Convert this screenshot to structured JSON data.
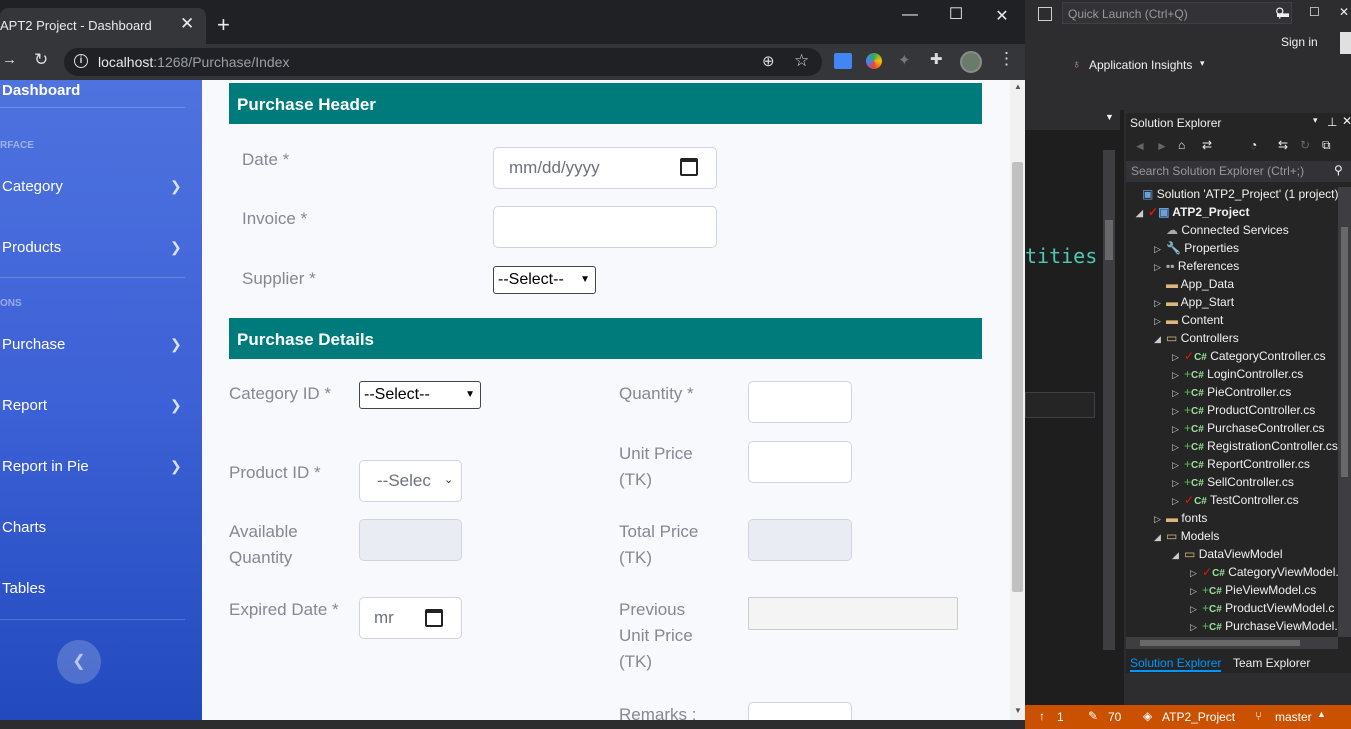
{
  "browser": {
    "tab_title": "APT2 Project - Dashboard",
    "url_host": "localhost",
    "url_rest": ":1268/Purchase/Index"
  },
  "sidebar": {
    "title": "Dashboard",
    "heading1": "RFACE",
    "heading2": "ONS",
    "items": [
      {
        "label": "Category"
      },
      {
        "label": "Products"
      },
      {
        "label": "Purchase"
      },
      {
        "label": "Report"
      },
      {
        "label": "Report in Pie"
      },
      {
        "label": "Charts"
      },
      {
        "label": "Tables"
      }
    ]
  },
  "form": {
    "header_title": "Purchase Header",
    "date_label": "Date *",
    "date_placeholder": "mm/dd/yyyy",
    "invoice_label": "Invoice *",
    "supplier_label": "Supplier *",
    "supplier_value": "--Select--",
    "details_title": "Purchase Details",
    "category_label": "Category ID *",
    "category_value": "--Select--",
    "product_label": "Product ID *",
    "product_value": "--Selec",
    "available_label": "Available Quantity",
    "expired_label": "Expired Date *",
    "expired_value": "mr",
    "quantity_label": "Quantity *",
    "unit_price_label": "Unit Price (TK)",
    "total_price_label": "Total Price (TK)",
    "prev_price_label": "Previous Unit Price (TK)",
    "remarks_label": "Remarks :"
  },
  "vs": {
    "quick_launch": "Quick Launch (Ctrl+Q)",
    "sign_in": "Sign in",
    "insights": "Application Insights",
    "code_text": "tities",
    "se_title": "Solution Explorer",
    "se_search": "Search Solution Explorer (Ctrl+;)",
    "tree": [
      "Solution 'ATP2_Project' (1 project)",
      "ATP2_Project",
      "Connected Services",
      "Properties",
      "References",
      "App_Data",
      "App_Start",
      "Content",
      "Controllers",
      "CategoryController.cs",
      "LoginController.cs",
      "PieController.cs",
      "ProductController.cs",
      "PurchaseController.cs",
      "RegistrationController.cs",
      "ReportController.cs",
      "SellController.cs",
      "TestController.cs",
      "fonts",
      "Models",
      "DataViewModel",
      "CategoryViewModel.",
      "PieViewModel.cs",
      "ProductViewModel.c",
      "PurchaseViewModel."
    ],
    "tab_se": "Solution Explorer",
    "tab_te": "Team Explorer",
    "status": {
      "arrow_count": "1",
      "pencil_count": "70",
      "project": "ATP2_Project",
      "branch": "master"
    }
  }
}
